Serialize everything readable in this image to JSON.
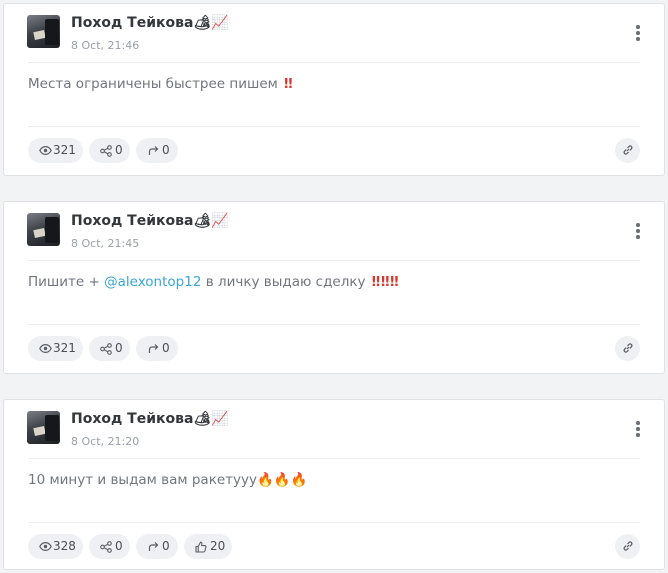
{
  "posts": [
    {
      "channel_name": "Поход Тейкова🏕📈",
      "date": "8 Oct, 21:46",
      "text_before": "Места ограничены быстрее пишем ",
      "mention": "",
      "text_after": "",
      "emphasis": "‼",
      "stats": {
        "views": "321",
        "shares": "0",
        "forwards": "0",
        "likes": ""
      }
    },
    {
      "channel_name": "Поход Тейкова🏕📈",
      "date": "8 Oct, 21:45",
      "text_before": "Пишите + ",
      "mention": "@alexontop12",
      "text_after": " в личку выдаю сделку ",
      "emphasis": "‼ ‼ ‼",
      "stats": {
        "views": "321",
        "shares": "0",
        "forwards": "0",
        "likes": ""
      }
    },
    {
      "channel_name": "Поход Тейкова🏕📈",
      "date": "8 Oct, 21:20",
      "text_before": "10 минут и выдам вам ракетууу",
      "mention": "",
      "text_after": "",
      "emphasis": "🔥🔥🔥",
      "stats": {
        "views": "328",
        "shares": "0",
        "forwards": "0",
        "likes": "20"
      }
    }
  ],
  "icons": {
    "views": "eye-icon",
    "shares": "share-icon",
    "forwards": "forward-icon",
    "likes": "thumbs-up-icon",
    "link": "link-icon",
    "menu": "more-vertical-icon"
  },
  "colors": {
    "background": "#f2f3f5",
    "card": "#ffffff",
    "mention": "#3aa6d8",
    "emphasis": "#d63a2f",
    "pill": "#eef0f3"
  }
}
